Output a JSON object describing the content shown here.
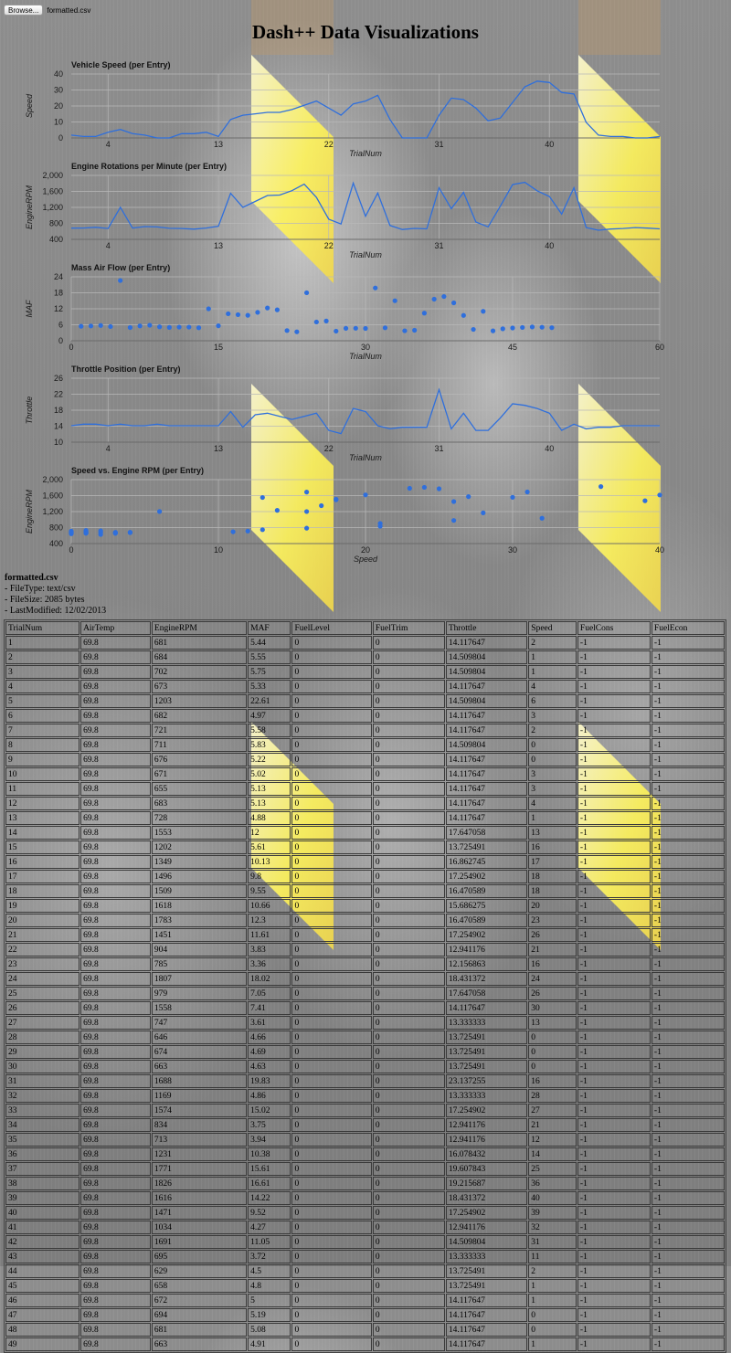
{
  "toolbar": {
    "browse_label": "Browse...",
    "file_name": "formatted.csv"
  },
  "page": {
    "title": "Dash++ Data Visualizations"
  },
  "file_info": {
    "name": "formatted.csv",
    "file_type": "- FileType: text/csv",
    "file_size": "- FileSize: 2085 bytes",
    "last_modified": "- LastModified: 12/02/2013"
  },
  "colors": {
    "series": "#2f6fdc",
    "grid": "#b8b8b8",
    "stripe": "#fff45a"
  },
  "table": {
    "columns": [
      "TrialNum",
      "AirTemp",
      "EngineRPM",
      "MAF",
      "FuelLevel",
      "FuelTrim",
      "Throttle",
      "Speed",
      "FuelCons",
      "FuelEcon"
    ],
    "rows": [
      [
        "1",
        "69.8",
        "681",
        "5.44",
        "0",
        "0",
        "14.117647",
        "2",
        "-1",
        "-1"
      ],
      [
        "2",
        "69.8",
        "684",
        "5.55",
        "0",
        "0",
        "14.509804",
        "1",
        "-1",
        "-1"
      ],
      [
        "3",
        "69.8",
        "702",
        "5.75",
        "0",
        "0",
        "14.509804",
        "1",
        "-1",
        "-1"
      ],
      [
        "4",
        "69.8",
        "673",
        "5.33",
        "0",
        "0",
        "14.117647",
        "4",
        "-1",
        "-1"
      ],
      [
        "5",
        "69.8",
        "1203",
        "22.61",
        "0",
        "0",
        "14.509804",
        "6",
        "-1",
        "-1"
      ],
      [
        "6",
        "69.8",
        "682",
        "4.97",
        "0",
        "0",
        "14.117647",
        "3",
        "-1",
        "-1"
      ],
      [
        "7",
        "69.8",
        "721",
        "5.58",
        "0",
        "0",
        "14.117647",
        "2",
        "-1",
        "-1"
      ],
      [
        "8",
        "69.8",
        "711",
        "5.83",
        "0",
        "0",
        "14.509804",
        "0",
        "-1",
        "-1"
      ],
      [
        "9",
        "69.8",
        "676",
        "5.22",
        "0",
        "0",
        "14.117647",
        "0",
        "-1",
        "-1"
      ],
      [
        "10",
        "69.8",
        "671",
        "5.02",
        "0",
        "0",
        "14.117647",
        "3",
        "-1",
        "-1"
      ],
      [
        "11",
        "69.8",
        "655",
        "5.13",
        "0",
        "0",
        "14.117647",
        "3",
        "-1",
        "-1"
      ],
      [
        "12",
        "69.8",
        "683",
        "5.13",
        "0",
        "0",
        "14.117647",
        "4",
        "-1",
        "-1"
      ],
      [
        "13",
        "69.8",
        "728",
        "4.88",
        "0",
        "0",
        "14.117647",
        "1",
        "-1",
        "-1"
      ],
      [
        "14",
        "69.8",
        "1553",
        "12",
        "0",
        "0",
        "17.647058",
        "13",
        "-1",
        "-1"
      ],
      [
        "15",
        "69.8",
        "1202",
        "5.61",
        "0",
        "0",
        "13.725491",
        "16",
        "-1",
        "-1"
      ],
      [
        "16",
        "69.8",
        "1349",
        "10.13",
        "0",
        "0",
        "16.862745",
        "17",
        "-1",
        "-1"
      ],
      [
        "17",
        "69.8",
        "1496",
        "9.8",
        "0",
        "0",
        "17.254902",
        "18",
        "-1",
        "-1"
      ],
      [
        "18",
        "69.8",
        "1509",
        "9.55",
        "0",
        "0",
        "16.470589",
        "18",
        "-1",
        "-1"
      ],
      [
        "19",
        "69.8",
        "1618",
        "10.66",
        "0",
        "0",
        "15.686275",
        "20",
        "-1",
        "-1"
      ],
      [
        "20",
        "69.8",
        "1783",
        "12.3",
        "0",
        "0",
        "16.470589",
        "23",
        "-1",
        "-1"
      ],
      [
        "21",
        "69.8",
        "1451",
        "11.61",
        "0",
        "0",
        "17.254902",
        "26",
        "-1",
        "-1"
      ],
      [
        "22",
        "69.8",
        "904",
        "3.83",
        "0",
        "0",
        "12.941176",
        "21",
        "-1",
        "-1"
      ],
      [
        "23",
        "69.8",
        "785",
        "3.36",
        "0",
        "0",
        "12.156863",
        "16",
        "-1",
        "-1"
      ],
      [
        "24",
        "69.8",
        "1807",
        "18.02",
        "0",
        "0",
        "18.431372",
        "24",
        "-1",
        "-1"
      ],
      [
        "25",
        "69.8",
        "979",
        "7.05",
        "0",
        "0",
        "17.647058",
        "26",
        "-1",
        "-1"
      ],
      [
        "26",
        "69.8",
        "1558",
        "7.41",
        "0",
        "0",
        "14.117647",
        "30",
        "-1",
        "-1"
      ],
      [
        "27",
        "69.8",
        "747",
        "3.61",
        "0",
        "0",
        "13.333333",
        "13",
        "-1",
        "-1"
      ],
      [
        "28",
        "69.8",
        "646",
        "4.66",
        "0",
        "0",
        "13.725491",
        "0",
        "-1",
        "-1"
      ],
      [
        "29",
        "69.8",
        "674",
        "4.69",
        "0",
        "0",
        "13.725491",
        "0",
        "-1",
        "-1"
      ],
      [
        "30",
        "69.8",
        "663",
        "4.63",
        "0",
        "0",
        "13.725491",
        "0",
        "-1",
        "-1"
      ],
      [
        "31",
        "69.8",
        "1688",
        "19.83",
        "0",
        "0",
        "23.137255",
        "16",
        "-1",
        "-1"
      ],
      [
        "32",
        "69.8",
        "1169",
        "4.86",
        "0",
        "0",
        "13.333333",
        "28",
        "-1",
        "-1"
      ],
      [
        "33",
        "69.8",
        "1574",
        "15.02",
        "0",
        "0",
        "17.254902",
        "27",
        "-1",
        "-1"
      ],
      [
        "34",
        "69.8",
        "834",
        "3.75",
        "0",
        "0",
        "12.941176",
        "21",
        "-1",
        "-1"
      ],
      [
        "35",
        "69.8",
        "713",
        "3.94",
        "0",
        "0",
        "12.941176",
        "12",
        "-1",
        "-1"
      ],
      [
        "36",
        "69.8",
        "1231",
        "10.38",
        "0",
        "0",
        "16.078432",
        "14",
        "-1",
        "-1"
      ],
      [
        "37",
        "69.8",
        "1771",
        "15.61",
        "0",
        "0",
        "19.607843",
        "25",
        "-1",
        "-1"
      ],
      [
        "38",
        "69.8",
        "1826",
        "16.61",
        "0",
        "0",
        "19.215687",
        "36",
        "-1",
        "-1"
      ],
      [
        "39",
        "69.8",
        "1616",
        "14.22",
        "0",
        "0",
        "18.431372",
        "40",
        "-1",
        "-1"
      ],
      [
        "40",
        "69.8",
        "1471",
        "9.52",
        "0",
        "0",
        "17.254902",
        "39",
        "-1",
        "-1"
      ],
      [
        "41",
        "69.8",
        "1034",
        "4.27",
        "0",
        "0",
        "12.941176",
        "32",
        "-1",
        "-1"
      ],
      [
        "42",
        "69.8",
        "1691",
        "11.05",
        "0",
        "0",
        "14.509804",
        "31",
        "-1",
        "-1"
      ],
      [
        "43",
        "69.8",
        "695",
        "3.72",
        "0",
        "0",
        "13.333333",
        "11",
        "-1",
        "-1"
      ],
      [
        "44",
        "69.8",
        "629",
        "4.5",
        "0",
        "0",
        "13.725491",
        "2",
        "-1",
        "-1"
      ],
      [
        "45",
        "69.8",
        "658",
        "4.8",
        "0",
        "0",
        "13.725491",
        "1",
        "-1",
        "-1"
      ],
      [
        "46",
        "69.8",
        "672",
        "5",
        "0",
        "0",
        "14.117647",
        "1",
        "-1",
        "-1"
      ],
      [
        "47",
        "69.8",
        "694",
        "5.19",
        "0",
        "0",
        "14.117647",
        "0",
        "-1",
        "-1"
      ],
      [
        "48",
        "69.8",
        "681",
        "5.08",
        "0",
        "0",
        "14.117647",
        "0",
        "-1",
        "-1"
      ],
      [
        "49",
        "69.8",
        "663",
        "4.91",
        "0",
        "0",
        "14.117647",
        "1",
        "-1",
        "-1"
      ]
    ]
  },
  "chart_data": [
    {
      "type": "line",
      "title": "Vehicle Speed (per Entry)",
      "xlabel": "TrialNum",
      "ylabel": "Speed",
      "x_ticks": [
        4,
        13,
        22,
        31,
        40
      ],
      "y_ticks": [
        "0",
        "10",
        "20",
        "30",
        "40"
      ],
      "xlim": [
        1,
        49
      ],
      "ylim": [
        0,
        45
      ],
      "grid": true,
      "series": [
        {
          "values": [
            2,
            1,
            1,
            4,
            6,
            3,
            2,
            0,
            0,
            3,
            3,
            4,
            1,
            13,
            16,
            17,
            18,
            18,
            20,
            23,
            26,
            21,
            16,
            24,
            26,
            30,
            13,
            0,
            0,
            0,
            16,
            28,
            27,
            21,
            12,
            14,
            25,
            36,
            40,
            39,
            32,
            31,
            11,
            2,
            1,
            1,
            0,
            0,
            1
          ]
        }
      ]
    },
    {
      "type": "line",
      "title": "Engine Rotations per Minute (per Entry)",
      "xlabel": "TrialNum",
      "ylabel": "EngineRPM",
      "x_ticks": [
        4,
        13,
        22,
        31,
        40
      ],
      "y_ticks": [
        "400",
        "800",
        "1,200",
        "1,600",
        "2,000"
      ],
      "xlim": [
        1,
        49
      ],
      "ylim": [
        400,
        2000
      ],
      "grid": true,
      "series": [
        {
          "values": [
            681,
            684,
            702,
            673,
            1203,
            682,
            721,
            711,
            676,
            671,
            655,
            683,
            728,
            1553,
            1202,
            1349,
            1496,
            1509,
            1618,
            1783,
            1451,
            904,
            785,
            1807,
            979,
            1558,
            747,
            646,
            674,
            663,
            1688,
            1169,
            1574,
            834,
            713,
            1231,
            1771,
            1826,
            1616,
            1471,
            1034,
            1691,
            695,
            629,
            658,
            672,
            694,
            681,
            663
          ]
        }
      ]
    },
    {
      "type": "scatter",
      "title": "Mass Air Flow (per Entry)",
      "xlabel": "TrialNum",
      "ylabel": "MAF",
      "x_ticks": [
        0,
        15,
        30,
        45,
        60
      ],
      "y_ticks": [
        "0",
        "6",
        "12",
        "18",
        "24"
      ],
      "xlim": [
        0,
        60
      ],
      "ylim": [
        0,
        24
      ],
      "grid": true,
      "series": [
        {
          "values": [
            5.44,
            5.55,
            5.75,
            5.33,
            22.61,
            4.97,
            5.58,
            5.83,
            5.22,
            5.02,
            5.13,
            5.13,
            4.88,
            12,
            5.61,
            10.13,
            9.8,
            9.55,
            10.66,
            12.3,
            11.61,
            3.83,
            3.36,
            18.02,
            7.05,
            7.41,
            3.61,
            4.66,
            4.69,
            4.63,
            19.83,
            4.86,
            15.02,
            3.75,
            3.94,
            10.38,
            15.61,
            16.61,
            14.22,
            9.52,
            4.27,
            11.05,
            3.72,
            4.5,
            4.8,
            5,
            5.19,
            5.08,
            4.91
          ]
        }
      ]
    },
    {
      "type": "line",
      "title": "Throttle Position (per Entry)",
      "xlabel": "TrialNum",
      "ylabel": "Throttle",
      "x_ticks": [
        4,
        13,
        22,
        31,
        40
      ],
      "y_ticks": [
        "10",
        "14",
        "18",
        "22",
        "26"
      ],
      "xlim": [
        1,
        49
      ],
      "ylim": [
        10,
        26
      ],
      "grid": true,
      "series": [
        {
          "values": [
            14.117647,
            14.509804,
            14.509804,
            14.117647,
            14.509804,
            14.117647,
            14.117647,
            14.509804,
            14.117647,
            14.117647,
            14.117647,
            14.117647,
            14.117647,
            17.647058,
            13.725491,
            16.862745,
            17.254902,
            16.470589,
            15.686275,
            16.470589,
            17.254902,
            12.941176,
            12.156863,
            18.431372,
            17.647058,
            14.117647,
            13.333333,
            13.725491,
            13.725491,
            13.725491,
            23.137255,
            13.333333,
            17.254902,
            12.941176,
            12.941176,
            16.078432,
            19.607843,
            19.215687,
            18.431372,
            17.254902,
            12.941176,
            14.509804,
            13.333333,
            13.725491,
            13.725491,
            14.117647,
            14.117647,
            14.117647,
            14.117647
          ]
        }
      ]
    },
    {
      "type": "scatter",
      "title": "Speed vs. Engine RPM (per Entry)",
      "xlabel": "Speed",
      "ylabel": "EngineRPM",
      "x_ticks": [
        0,
        10,
        20,
        30,
        40
      ],
      "y_ticks": [
        "400",
        "800",
        "1,200",
        "1,600",
        "2,000"
      ],
      "xlim": [
        0,
        40
      ],
      "ylim": [
        400,
        2000
      ],
      "grid": true,
      "series": [
        {
          "x": [
            2,
            1,
            1,
            4,
            6,
            3,
            2,
            0,
            0,
            3,
            3,
            4,
            1,
            13,
            16,
            17,
            18,
            18,
            20,
            23,
            26,
            21,
            16,
            24,
            26,
            30,
            13,
            0,
            0,
            0,
            16,
            28,
            27,
            21,
            12,
            14,
            25,
            36,
            40,
            39,
            32,
            31,
            11,
            2,
            1,
            1,
            0,
            0,
            1
          ],
          "y": [
            681,
            684,
            702,
            673,
            1203,
            682,
            721,
            711,
            676,
            671,
            655,
            683,
            728,
            1553,
            1202,
            1349,
            1496,
            1509,
            1618,
            1783,
            1451,
            904,
            785,
            1807,
            979,
            1558,
            747,
            646,
            674,
            663,
            1688,
            1169,
            1574,
            834,
            713,
            1231,
            1771,
            1826,
            1616,
            1471,
            1034,
            1691,
            695,
            629,
            658,
            672,
            694,
            681,
            663
          ]
        }
      ]
    }
  ]
}
